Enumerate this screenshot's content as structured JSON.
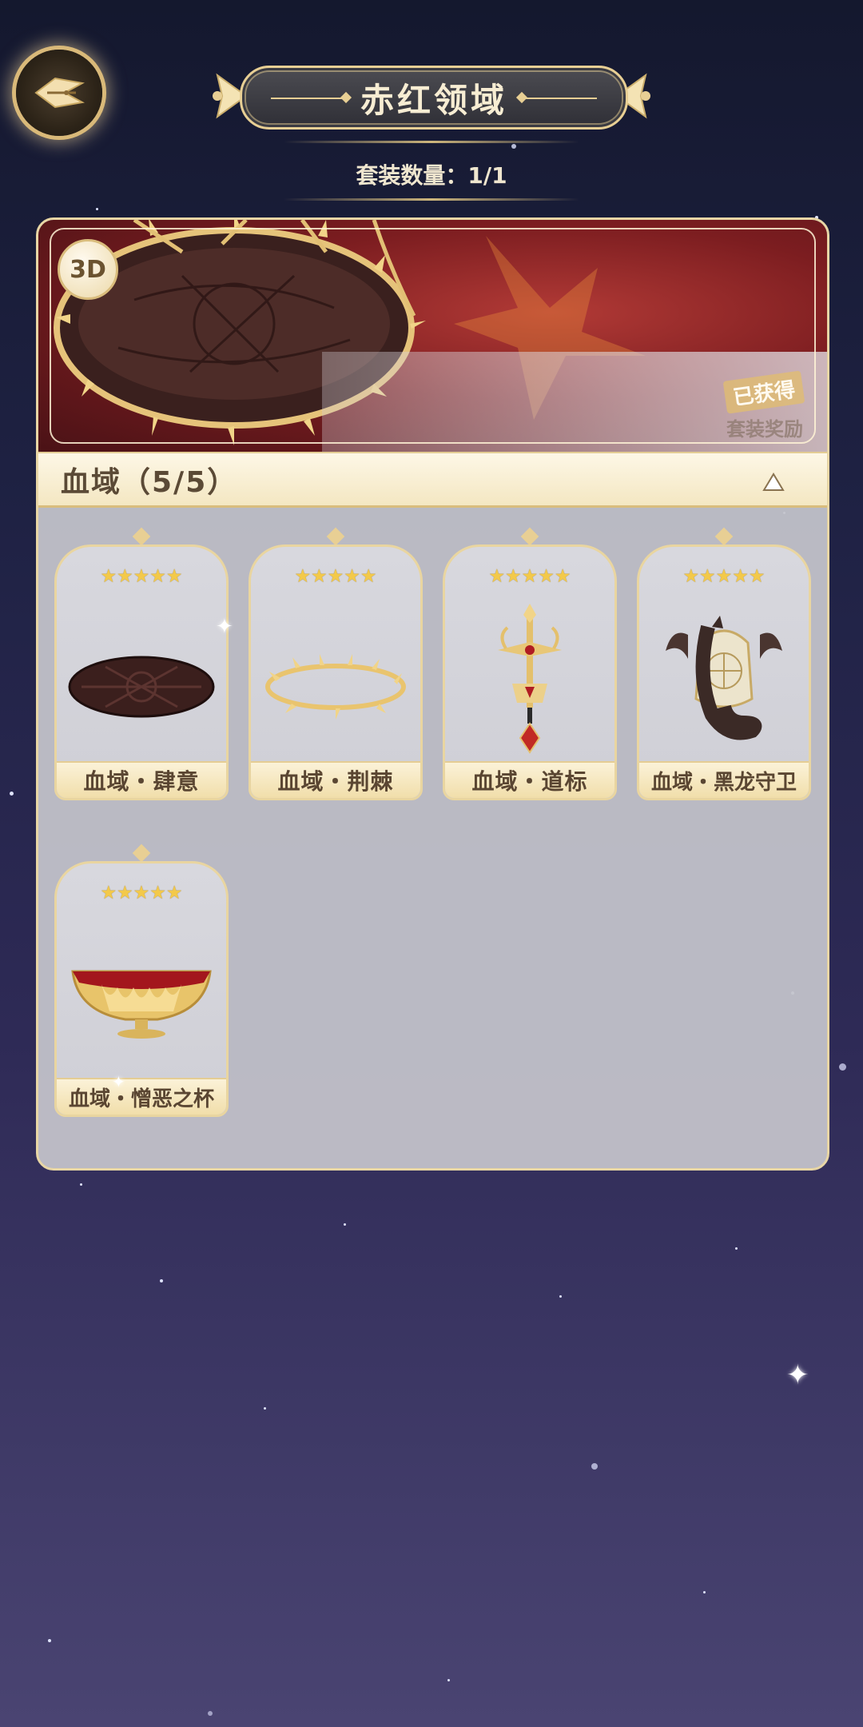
{
  "header": {
    "title": "赤红领域",
    "set_count_text": "套装数量：1/1"
  },
  "banner": {
    "badge_3d": "3D",
    "obtained_tag": "已获得",
    "obtained_sub": "套装奖励"
  },
  "set": {
    "title": "血域（5/5）",
    "items": [
      {
        "label": "血域・肆意",
        "stars": "★★★★★"
      },
      {
        "label": "血域・荆棘",
        "stars": "★★★★★"
      },
      {
        "label": "血域・道标",
        "stars": "★★★★★"
      },
      {
        "label": "血域・黑龙守卫",
        "stars": "★★★★★"
      },
      {
        "label": "血域・憎恶之杯",
        "stars": "★★★★★"
      }
    ]
  },
  "colors": {
    "accent_gold": "#e8cf94",
    "panel_bg": "#c4c4cb",
    "label_text": "#5a4632"
  },
  "icons": [
    "back-icon",
    "collapse-up-icon",
    "star-icon"
  ]
}
